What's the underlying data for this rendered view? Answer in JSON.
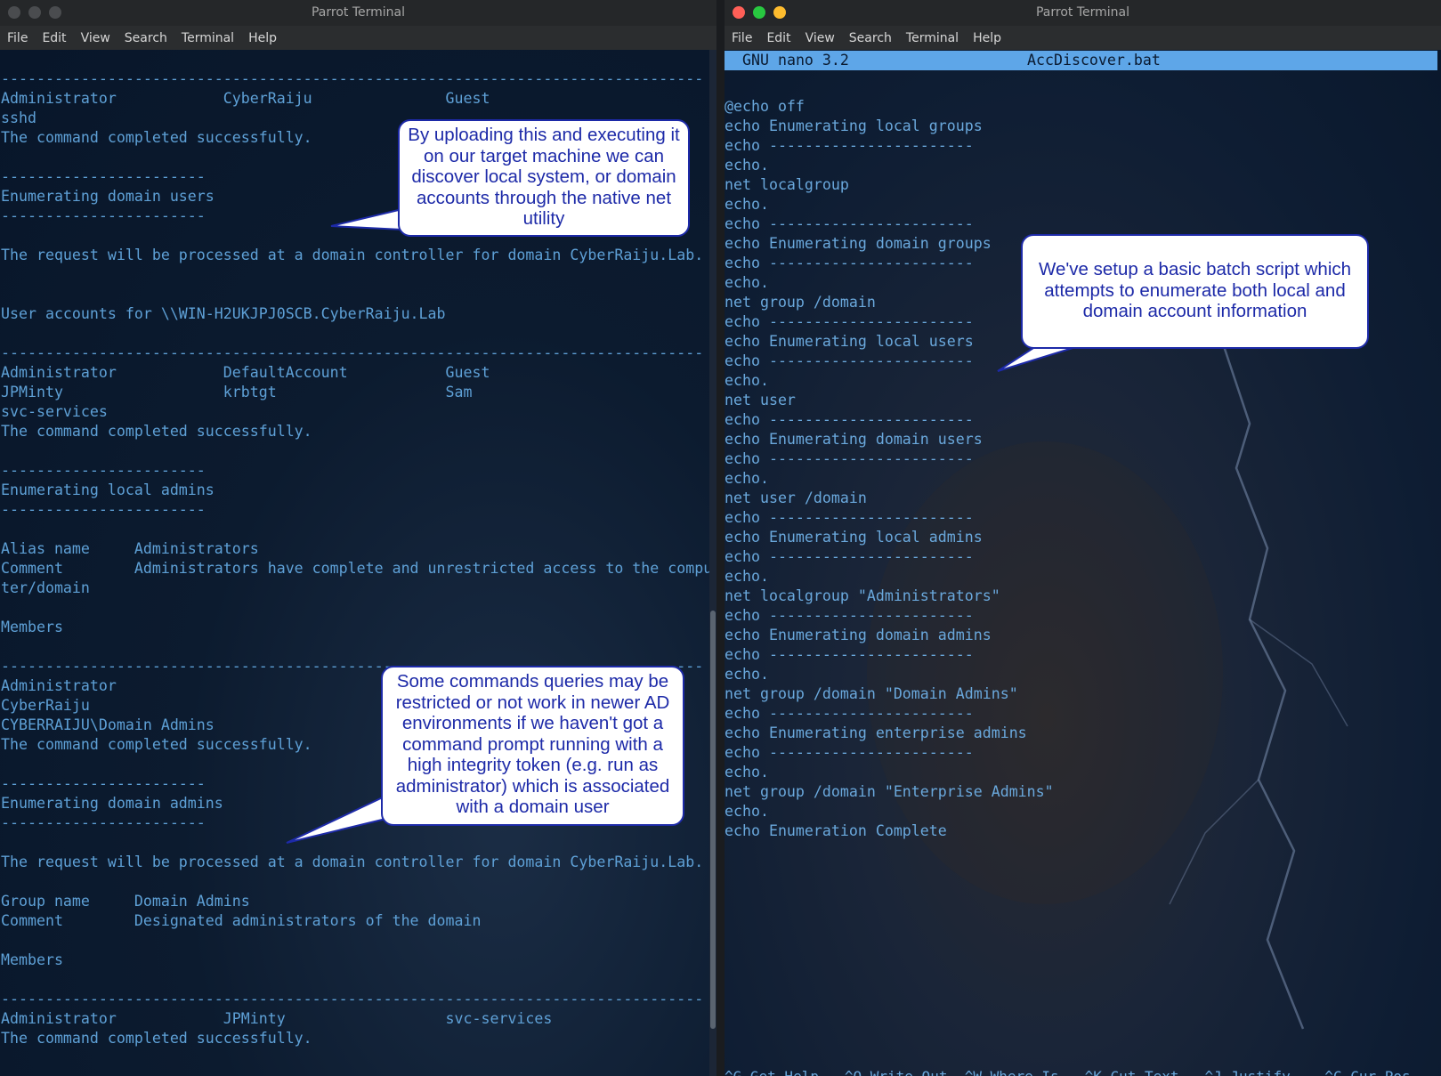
{
  "left_window": {
    "title": "Parrot Terminal",
    "menu": [
      "File",
      "Edit",
      "View",
      "Search",
      "Terminal",
      "Help"
    ],
    "lines": [
      "-------------------------------------------------------------------------------",
      "Administrator            CyberRaiju               Guest",
      "sshd",
      "The command completed successfully.",
      "",
      "-----------------------",
      "Enumerating domain users",
      "-----------------------",
      "",
      "The request will be processed at a domain controller for domain CyberRaiju.Lab.",
      "",
      "",
      "User accounts for \\\\WIN-H2UKJPJ0SCB.CyberRaiju.Lab",
      "",
      "-------------------------------------------------------------------------------",
      "Administrator            DefaultAccount           Guest",
      "JPMinty                  krbtgt                   Sam",
      "svc-services",
      "The command completed successfully.",
      "",
      "-----------------------",
      "Enumerating local admins",
      "-----------------------",
      "",
      "Alias name     Administrators",
      "Comment        Administrators have complete and unrestricted access to the compu",
      "ter/domain",
      "",
      "Members",
      "",
      "-------------------------------------------------------------------------------",
      "Administrator",
      "CyberRaiju",
      "CYBERRAIJU\\Domain Admins",
      "The command completed successfully.",
      "",
      "-----------------------",
      "Enumerating domain admins",
      "-----------------------",
      "",
      "The request will be processed at a domain controller for domain CyberRaiju.Lab.",
      "",
      "Group name     Domain Admins",
      "Comment        Designated administrators of the domain",
      "",
      "Members",
      "",
      "-------------------------------------------------------------------------------",
      "Administrator            JPMinty                  svc-services",
      "The command completed successfully."
    ]
  },
  "right_window": {
    "title": "Parrot Terminal",
    "menu": [
      "File",
      "Edit",
      "View",
      "Search",
      "Terminal",
      "Help"
    ],
    "nano_version": "GNU nano 3.2",
    "filename": "AccDiscover.bat",
    "lines": [
      "@echo off",
      "echo Enumerating local groups",
      "echo -----------------------",
      "echo.",
      "net localgroup",
      "echo.",
      "echo -----------------------",
      "echo Enumerating domain groups",
      "echo -----------------------",
      "echo.",
      "net group /domain",
      "echo -----------------------",
      "echo Enumerating local users",
      "echo -----------------------",
      "echo.",
      "net user",
      "echo -----------------------",
      "echo Enumerating domain users",
      "echo -----------------------",
      "echo.",
      "net user /domain",
      "echo -----------------------",
      "echo Enumerating local admins",
      "echo -----------------------",
      "echo.",
      "net localgroup \"Administrators\"",
      "echo -----------------------",
      "echo Enumerating domain admins",
      "echo -----------------------",
      "echo.",
      "net group /domain \"Domain Admins\"",
      "echo -----------------------",
      "echo Enumerating enterprise admins",
      "echo -----------------------",
      "echo.",
      "net group /domain \"Enterprise Admins\"",
      "echo.",
      "echo Enumeration Complete"
    ],
    "shortcuts_text": "^G Get Help   ^O Write Out  ^W Where Is   ^K Cut Text   ^J Justify    ^C Cur Pos"
  },
  "callouts": {
    "upload": "By uploading this and executing it on our target machine we can discover local system, or domain accounts through the native net utility",
    "batch": "We've setup a basic batch script which attempts to enumerate both local and domain account information",
    "restricted": "Some commands queries may be restricted or not work in newer AD environments if we haven't got a command prompt running with a high integrity token (e.g. run as administrator) which is associated with a domain user"
  },
  "colors": {
    "terminal_text": "#5ea0d6",
    "nano_bar": "#5ea6e8",
    "callout_border": "#1d2aa8",
    "close": "#ff5f57",
    "minimize": "#febc2e",
    "maximize": "#28c840"
  }
}
